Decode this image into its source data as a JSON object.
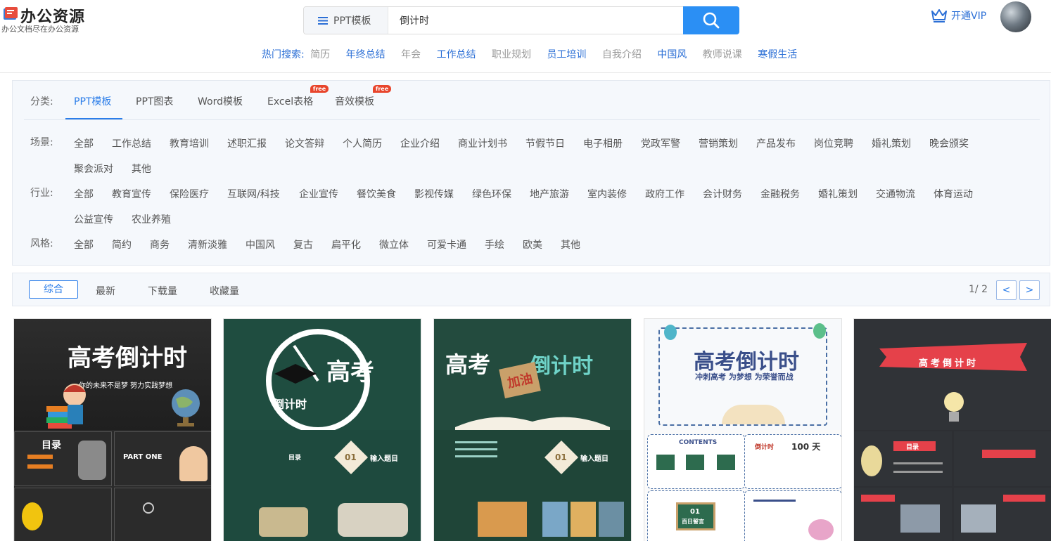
{
  "header": {
    "logo_name": "办公资源",
    "logo_slogan": "办公文档尽在办公资源",
    "search_type": "PPT模板",
    "search_value": "倒计时",
    "vip_label": "开通VIP",
    "hot_label": "热门搜索:",
    "hot_terms": [
      {
        "text": "简历",
        "style": "gray"
      },
      {
        "text": "年终总结",
        "style": "blue"
      },
      {
        "text": "年会",
        "style": "gray"
      },
      {
        "text": "工作总结",
        "style": "blue"
      },
      {
        "text": "职业规划",
        "style": "gray"
      },
      {
        "text": "员工培训",
        "style": "blue"
      },
      {
        "text": "自我介绍",
        "style": "gray"
      },
      {
        "text": "中国风",
        "style": "blue"
      },
      {
        "text": "教师说课",
        "style": "gray"
      },
      {
        "text": "寒假生活",
        "style": "blue"
      }
    ]
  },
  "filter": {
    "category_label": "分类:",
    "categories": [
      {
        "label": "PPT模板",
        "active": true,
        "free": false
      },
      {
        "label": "PPT图表",
        "active": false,
        "free": false
      },
      {
        "label": "Word模板",
        "active": false,
        "free": false
      },
      {
        "label": "Excel表格",
        "active": false,
        "free": true
      },
      {
        "label": "音效模板",
        "active": false,
        "free": true
      }
    ],
    "free_badge": "free",
    "scene_label": "场景:",
    "scenes": [
      "全部",
      "工作总结",
      "教育培训",
      "述职汇报",
      "论文答辩",
      "个人简历",
      "企业介绍",
      "商业计划书",
      "节假节日",
      "电子相册",
      "党政军警",
      "营销策划",
      "产品发布",
      "岗位竞聘",
      "婚礼策划",
      "晚会颁奖",
      "聚会派对",
      "其他"
    ],
    "industry_label": "行业:",
    "industries": [
      "全部",
      "教育宣传",
      "保险医疗",
      "互联网/科技",
      "企业宣传",
      "餐饮美食",
      "影视传媒",
      "绿色环保",
      "地产旅游",
      "室内装修",
      "政府工作",
      "会计财务",
      "金融税务",
      "婚礼策划",
      "交通物流",
      "体育运动",
      "公益宣传",
      "农业养殖"
    ],
    "style_label": "风格:",
    "styles": [
      "全部",
      "简约",
      "商务",
      "清新淡雅",
      "中国风",
      "复古",
      "扁平化",
      "微立体",
      "可爱卡通",
      "手绘",
      "欧美",
      "其他"
    ]
  },
  "sort": {
    "options": [
      "综合",
      "最新",
      "下载量",
      "收藏量"
    ],
    "pager": "1/ 2",
    "prev": "<",
    "next": ">"
  },
  "cards": [
    {
      "title": "高考倒计时",
      "subtitle": "你的未来不是梦 努力实践梦想",
      "sub1": "目录",
      "sub2": "PART ONE"
    },
    {
      "title": "高考",
      "subtitle": "倒计时",
      "sub1": "目录",
      "sub2": "输入题目",
      "num": "01"
    },
    {
      "title": "高考",
      "subtitle": "倒计时",
      "badge": "加油",
      "sub2": "输入题目",
      "num": "01"
    },
    {
      "title": "高考倒计时",
      "subtitle": "冲刺高考 为梦想 为荣誉而战",
      "sub1": "CONTENTS",
      "sub2": "倒计时",
      "days": "100 天",
      "sub3": "百日誓言",
      "num": "01"
    },
    {
      "title": "高考倒计时",
      "sub1": "目录"
    }
  ]
}
